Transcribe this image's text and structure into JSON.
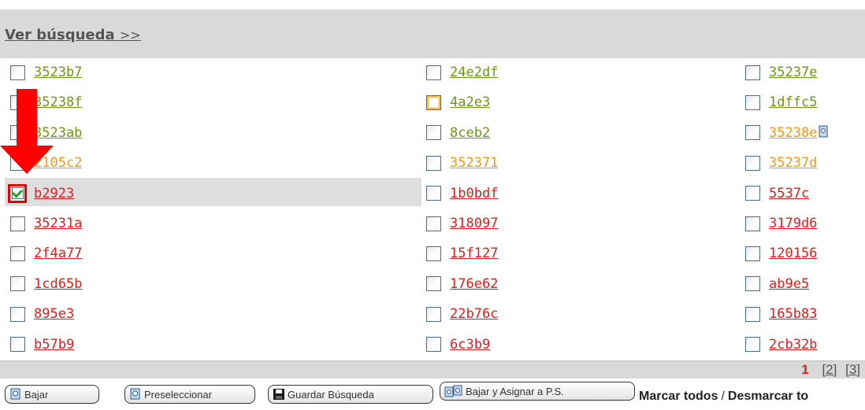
{
  "header": {
    "ver_busqueda_label": "Ver búsqueda",
    "ver_busqueda_arrows": ">>"
  },
  "colors": {
    "green_link": "#6b9a12",
    "orange_link": "#f39a1a",
    "red_link": "#e41b1b",
    "header_bg": "#d9d9d9",
    "highlight_bg": "#dedede",
    "checked_outline": "#e00000"
  },
  "grid": {
    "col1": [
      {
        "label": "3523b7",
        "color": "green",
        "checked": false
      },
      {
        "label": "35238f",
        "color": "green",
        "checked": false
      },
      {
        "label": "3523ab",
        "color": "green",
        "checked": false
      },
      {
        "label": "2105c2",
        "color": "orange",
        "checked": false
      },
      {
        "label": "b2923",
        "color": "red",
        "checked": true
      },
      {
        "label": "35231a",
        "color": "red",
        "checked": false
      },
      {
        "label": "2f4a77",
        "color": "red",
        "checked": false
      },
      {
        "label": "1cd65b",
        "color": "red",
        "checked": false
      },
      {
        "label": "895e3",
        "color": "red",
        "checked": false
      },
      {
        "label": "b57b9",
        "color": "red",
        "checked": false
      }
    ],
    "col2": [
      {
        "label": "24e2df",
        "color": "green",
        "checked": false
      },
      {
        "label": "4a2e3",
        "color": "green",
        "checked": false,
        "hover": true
      },
      {
        "label": "8ceb2",
        "color": "green",
        "checked": false
      },
      {
        "label": "352371",
        "color": "orange",
        "checked": false
      },
      {
        "label": "1b0bdf",
        "color": "red",
        "checked": false
      },
      {
        "label": "318097",
        "color": "red",
        "checked": false
      },
      {
        "label": "15f127",
        "color": "red",
        "checked": false
      },
      {
        "label": "176e62",
        "color": "red",
        "checked": false
      },
      {
        "label": "22b76c",
        "color": "red",
        "checked": false
      },
      {
        "label": "6c3b9",
        "color": "red",
        "checked": false
      }
    ],
    "col3": [
      {
        "label": "35237e",
        "color": "green",
        "checked": false
      },
      {
        "label": "1dffc5",
        "color": "green",
        "checked": false
      },
      {
        "label": "35238e",
        "color": "orange",
        "checked": false,
        "icon": "document-icon"
      },
      {
        "label": "35237d",
        "color": "orange",
        "checked": false
      },
      {
        "label": "5537c",
        "color": "red",
        "checked": false
      },
      {
        "label": "3179d6",
        "color": "red",
        "checked": false
      },
      {
        "label": "120156",
        "color": "red",
        "checked": false
      },
      {
        "label": "ab9e5",
        "color": "red",
        "checked": false
      },
      {
        "label": "165b83",
        "color": "red",
        "checked": false
      },
      {
        "label": "2cb32b",
        "color": "red",
        "checked": false
      }
    ]
  },
  "pager": {
    "current": "1",
    "pages": [
      "[2]",
      "[3]"
    ]
  },
  "buttons": {
    "bajar": "Bajar",
    "preseleccionar": "Preseleccionar",
    "guardar": "Guardar Búsqueda",
    "bajar_asignar": "Bajar y Asignar a P.S."
  },
  "marcar": {
    "marcar_todos": "Marcar todos",
    "separator": "/",
    "desmarcar": "Desmarcar to"
  }
}
